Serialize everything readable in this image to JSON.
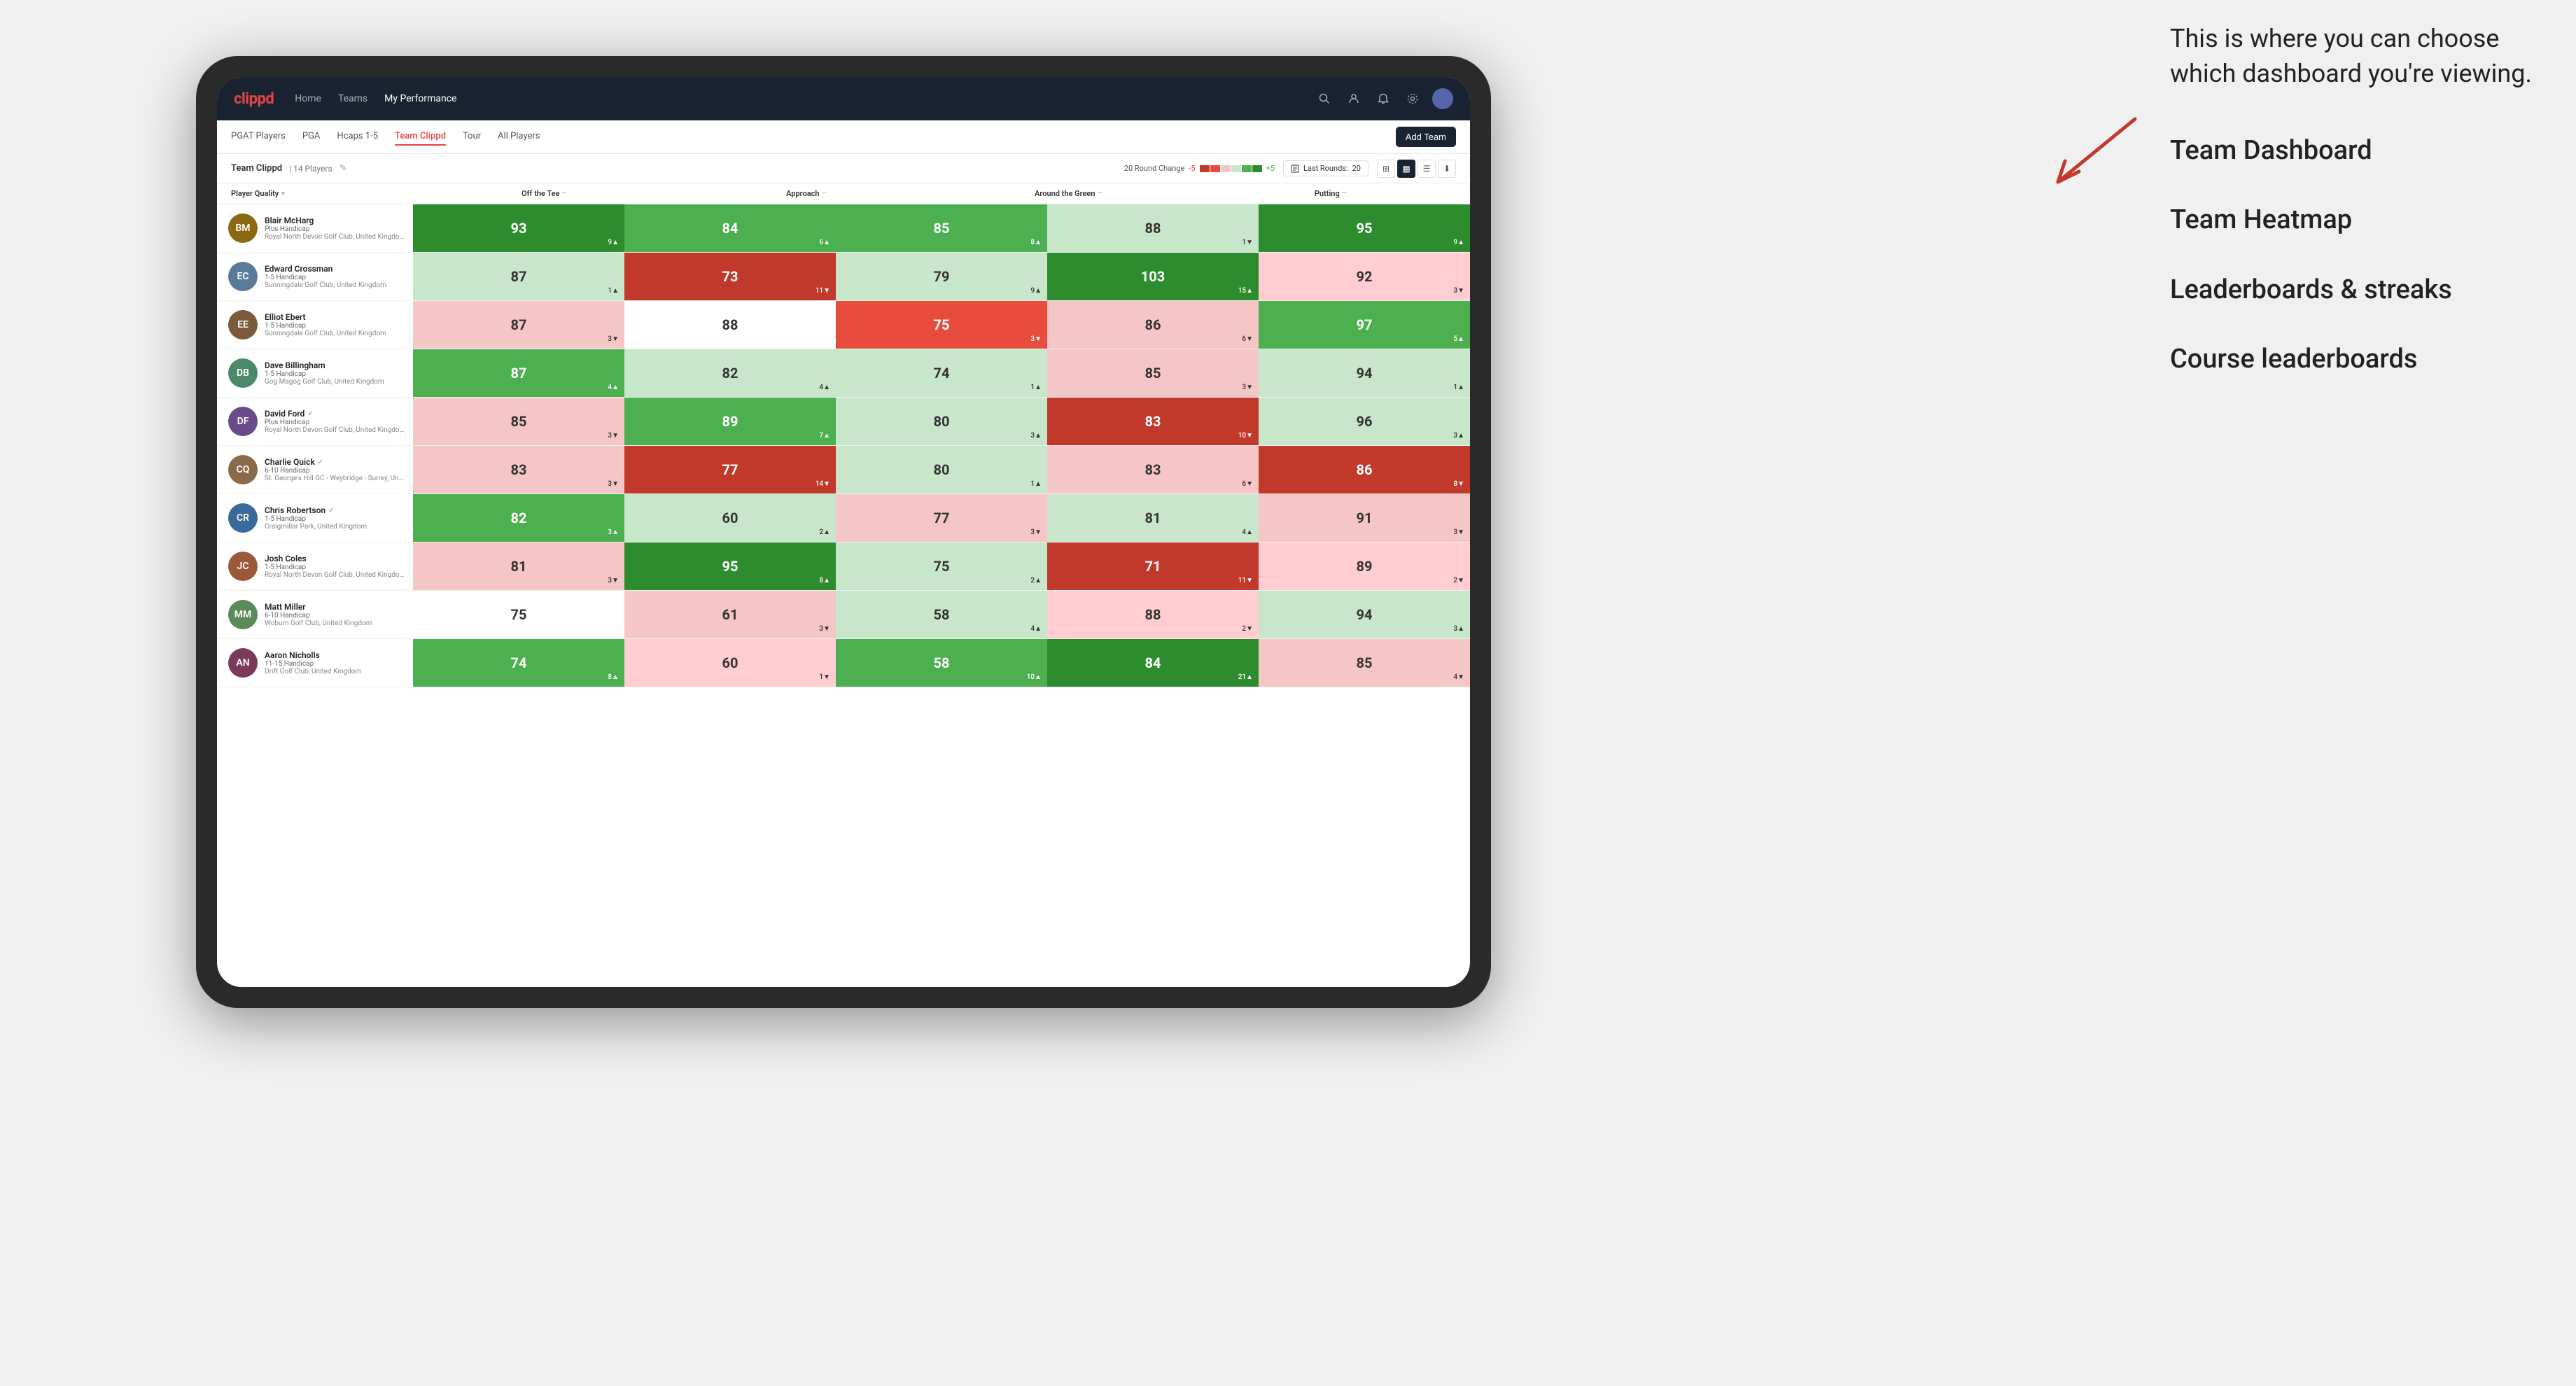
{
  "annotation": {
    "intro": "This is where you can choose which dashboard you're viewing.",
    "items": [
      "Team Dashboard",
      "Team Heatmap",
      "Leaderboards & streaks",
      "Course leaderboards"
    ]
  },
  "nav": {
    "logo": "clippd",
    "links": [
      "Home",
      "Teams",
      "My Performance"
    ],
    "active_link": "My Performance"
  },
  "secondary_nav": {
    "links": [
      "PGAT Players",
      "PGA",
      "Hcaps 1-5",
      "Team Clippd",
      "Tour",
      "All Players"
    ],
    "active_link": "Team Clippd",
    "add_team_label": "Add Team"
  },
  "team_header": {
    "name": "Team Clippd",
    "separator": "|",
    "player_count": "14 Players",
    "round_change_label": "20 Round Change",
    "neg_label": "-5",
    "pos_label": "+5",
    "last_rounds_label": "Last Rounds:",
    "last_rounds_value": "20"
  },
  "columns": {
    "player_quality": "Player Quality",
    "off_tee": "Off the Tee",
    "approach": "Approach",
    "around_green": "Around the Green",
    "putting": "Putting"
  },
  "players": [
    {
      "name": "Blair McHarg",
      "handicap": "Plus Handicap",
      "club": "Royal North Devon Golf Club, United Kingdom",
      "initials": "BM",
      "color": "#8B6914",
      "player_quality": {
        "value": "93",
        "change": "9▲",
        "type": "green-dark"
      },
      "off_tee": {
        "value": "84",
        "change": "6▲",
        "type": "green-med"
      },
      "approach": {
        "value": "85",
        "change": "8▲",
        "type": "green-med"
      },
      "around_green": {
        "value": "88",
        "change": "1▼",
        "type": "light-green"
      },
      "putting": {
        "value": "95",
        "change": "9▲",
        "type": "green-dark"
      }
    },
    {
      "name": "Edward Crossman",
      "handicap": "1-5 Handicap",
      "club": "Sunningdale Golf Club, United Kingdom",
      "initials": "EC",
      "color": "#5a7a9a",
      "player_quality": {
        "value": "87",
        "change": "1▲",
        "type": "light-green"
      },
      "off_tee": {
        "value": "73",
        "change": "11▼",
        "type": "red-dark"
      },
      "approach": {
        "value": "79",
        "change": "9▲",
        "type": "light-green"
      },
      "around_green": {
        "value": "103",
        "change": "15▲",
        "type": "green-dark"
      },
      "putting": {
        "value": "92",
        "change": "3▼",
        "type": "light-red"
      }
    },
    {
      "name": "Elliot Ebert",
      "handicap": "1-5 Handicap",
      "club": "Sunningdale Golf Club, United Kingdom",
      "initials": "EE",
      "color": "#7a5a3a",
      "player_quality": {
        "value": "87",
        "change": "3▼",
        "type": "red-light"
      },
      "off_tee": {
        "value": "88",
        "change": "",
        "type": "neutral"
      },
      "approach": {
        "value": "75",
        "change": "3▼",
        "type": "red-med"
      },
      "around_green": {
        "value": "86",
        "change": "6▼",
        "type": "red-light"
      },
      "putting": {
        "value": "97",
        "change": "5▲",
        "type": "green-med"
      }
    },
    {
      "name": "Dave Billingham",
      "handicap": "1-5 Handicap",
      "club": "Gog Magog Golf Club, United Kingdom",
      "initials": "DB",
      "color": "#4a8a6a",
      "player_quality": {
        "value": "87",
        "change": "4▲",
        "type": "green-med"
      },
      "off_tee": {
        "value": "82",
        "change": "4▲",
        "type": "light-green"
      },
      "approach": {
        "value": "74",
        "change": "1▲",
        "type": "light-green"
      },
      "around_green": {
        "value": "85",
        "change": "3▼",
        "type": "red-light"
      },
      "putting": {
        "value": "94",
        "change": "1▲",
        "type": "light-green"
      }
    },
    {
      "name": "David Ford",
      "handicap": "Plus Handicap",
      "club": "Royal North Devon Golf Club, United Kingdom",
      "initials": "DF",
      "color": "#6a4a8a",
      "verified": true,
      "player_quality": {
        "value": "85",
        "change": "3▼",
        "type": "red-light"
      },
      "off_tee": {
        "value": "89",
        "change": "7▲",
        "type": "green-med"
      },
      "approach": {
        "value": "80",
        "change": "3▲",
        "type": "light-green"
      },
      "around_green": {
        "value": "83",
        "change": "10▼",
        "type": "red-dark"
      },
      "putting": {
        "value": "96",
        "change": "3▲",
        "type": "light-green"
      }
    },
    {
      "name": "Charlie Quick",
      "handicap": "6-10 Handicap",
      "club": "St. George's Hill GC - Weybridge - Surrey, Uni...",
      "initials": "CQ",
      "color": "#8a6a4a",
      "verified": true,
      "player_quality": {
        "value": "83",
        "change": "3▼",
        "type": "red-light"
      },
      "off_tee": {
        "value": "77",
        "change": "14▼",
        "type": "red-dark"
      },
      "approach": {
        "value": "80",
        "change": "1▲",
        "type": "light-green"
      },
      "around_green": {
        "value": "83",
        "change": "6▼",
        "type": "red-light"
      },
      "putting": {
        "value": "86",
        "change": "8▼",
        "type": "red-dark"
      }
    },
    {
      "name": "Chris Robertson",
      "handicap": "1-5 Handicap",
      "club": "Craigmillar Park, United Kingdom",
      "initials": "CR",
      "color": "#3a6a9a",
      "verified": true,
      "player_quality": {
        "value": "82",
        "change": "3▲",
        "type": "green-med"
      },
      "off_tee": {
        "value": "60",
        "change": "2▲",
        "type": "light-green"
      },
      "approach": {
        "value": "77",
        "change": "3▼",
        "type": "red-light"
      },
      "around_green": {
        "value": "81",
        "change": "4▲",
        "type": "light-green"
      },
      "putting": {
        "value": "91",
        "change": "3▼",
        "type": "red-light"
      }
    },
    {
      "name": "Josh Coles",
      "handicap": "1-5 Handicap",
      "club": "Royal North Devon Golf Club, United Kingdom",
      "initials": "JC",
      "color": "#9a5a3a",
      "player_quality": {
        "value": "81",
        "change": "3▼",
        "type": "red-light"
      },
      "off_tee": {
        "value": "95",
        "change": "8▲",
        "type": "green-dark"
      },
      "approach": {
        "value": "75",
        "change": "2▲",
        "type": "light-green"
      },
      "around_green": {
        "value": "71",
        "change": "11▼",
        "type": "red-dark"
      },
      "putting": {
        "value": "89",
        "change": "2▼",
        "type": "light-red"
      }
    },
    {
      "name": "Matt Miller",
      "handicap": "6-10 Handicap",
      "club": "Woburn Golf Club, United Kingdom",
      "initials": "MM",
      "color": "#5a8a5a",
      "player_quality": {
        "value": "75",
        "change": "",
        "type": "neutral"
      },
      "off_tee": {
        "value": "61",
        "change": "3▼",
        "type": "red-light"
      },
      "approach": {
        "value": "58",
        "change": "4▲",
        "type": "light-green"
      },
      "around_green": {
        "value": "88",
        "change": "2▼",
        "type": "light-red"
      },
      "putting": {
        "value": "94",
        "change": "3▲",
        "type": "light-green"
      }
    },
    {
      "name": "Aaron Nicholls",
      "handicap": "11-15 Handicap",
      "club": "Drift Golf Club, United Kingdom",
      "initials": "AN",
      "color": "#7a3a5a",
      "player_quality": {
        "value": "74",
        "change": "8▲",
        "type": "green-med"
      },
      "off_tee": {
        "value": "60",
        "change": "1▼",
        "type": "light-red"
      },
      "approach": {
        "value": "58",
        "change": "10▲",
        "type": "green-med"
      },
      "around_green": {
        "value": "84",
        "change": "21▲",
        "type": "green-dark"
      },
      "putting": {
        "value": "85",
        "change": "4▼",
        "type": "red-light"
      }
    }
  ]
}
